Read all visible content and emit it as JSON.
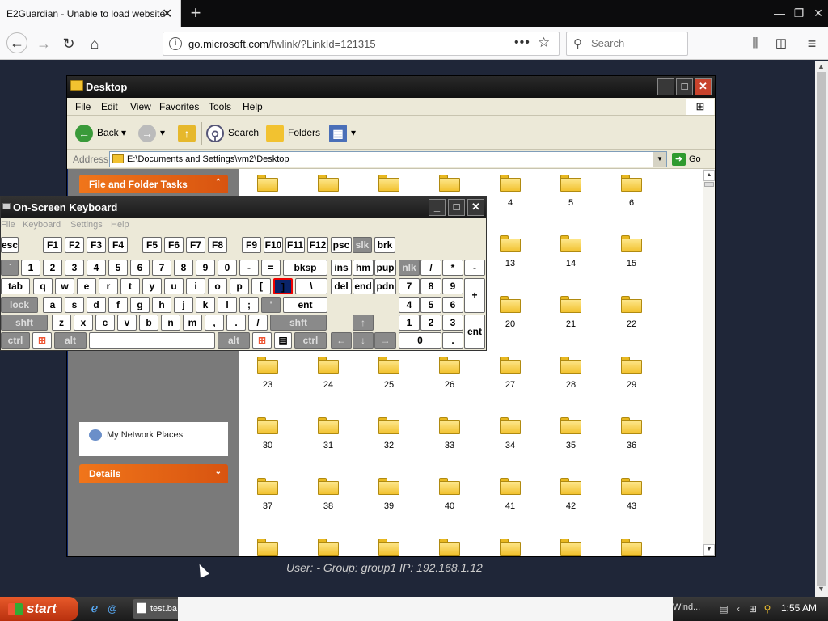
{
  "browser": {
    "tab_title": "E2Guardian - Unable to load website",
    "url_domain": "go.microsoft.com",
    "url_path": "/fwlink/?LinkId=121315",
    "search_placeholder": "Search"
  },
  "explorer": {
    "title": "Desktop",
    "menu": [
      "File",
      "Edit",
      "View",
      "Favorites",
      "Tools",
      "Help"
    ],
    "toolbar": {
      "back": "Back",
      "search": "Search",
      "folders": "Folders"
    },
    "address_label": "Address",
    "address_value": "E:\\Documents and Settings\\vm2\\Desktop",
    "go_label": "Go",
    "panels": {
      "tasks": "File and Folder Tasks",
      "network_places": "My Network Places",
      "details": "Details"
    },
    "files": [
      "",
      "",
      "",
      "",
      "4",
      "5",
      "6",
      "",
      "",
      "",
      "",
      "13",
      "14",
      "15",
      "",
      "",
      "",
      "",
      "20",
      "21",
      "22",
      "23",
      "24",
      "25",
      "26",
      "27",
      "28",
      "29",
      "30",
      "31",
      "32",
      "33",
      "34",
      "35",
      "36",
      "37",
      "38",
      "39",
      "40",
      "41",
      "42",
      "43",
      "",
      "",
      "",
      "",
      "",
      "",
      ""
    ]
  },
  "status_line": "User: -    Group: group1   IP: 192.168.1.12",
  "osk": {
    "title": "On-Screen Keyboard",
    "menu": [
      "File",
      "Keyboard",
      "Settings",
      "Help"
    ],
    "keys": {
      "esc": "esc",
      "f1": "F1",
      "f2": "F2",
      "f3": "F3",
      "f4": "F4",
      "f5": "F5",
      "f6": "F6",
      "f7": "F7",
      "f8": "F8",
      "f9": "F9",
      "f10": "F10",
      "f11": "F11",
      "f12": "F12",
      "psc": "psc",
      "slk": "slk",
      "brk": "brk",
      "grave": "`",
      "n1": "1",
      "n2": "2",
      "n3": "3",
      "n4": "4",
      "n5": "5",
      "n6": "6",
      "n7": "7",
      "n8": "8",
      "n9": "9",
      "n0": "0",
      "minus": "-",
      "equals": "=",
      "bksp": "bksp",
      "ins": "ins",
      "hm": "hm",
      "pup": "pup",
      "nlk": "nlk",
      "div": "/",
      "mul": "*",
      "sub": "-",
      "tab": "tab",
      "q": "q",
      "w": "w",
      "e": "e",
      "r": "r",
      "t": "t",
      "y": "y",
      "u": "u",
      "i": "i",
      "o": "o",
      "p": "p",
      "lbr": "[",
      "rbr": "]",
      "bsl": "\\",
      "del": "del",
      "end": "end",
      "pdn": "pdn",
      "k7": "7",
      "k8": "8",
      "k9": "9",
      "add": "+",
      "lock": "lock",
      "a": "a",
      "s": "s",
      "d": "d",
      "f": "f",
      "g": "g",
      "h": "h",
      "j": "j",
      "k": "k",
      "l": "l",
      "semi": ";",
      "quote": "'",
      "ent": "ent",
      "k4": "4",
      "k5": "5",
      "k6": "6",
      "lshft": "shft",
      "z": "z",
      "x": "x",
      "c": "c",
      "v": "v",
      "b": "b",
      "n": "n",
      "m": "m",
      "comma": ",",
      "period": ".",
      "slash": "/",
      "rshft": "shft",
      "up": "↑",
      "k1": "1",
      "k2": "2",
      "k3": "3",
      "kent": "ent",
      "lctrl": "ctrl",
      "lalt": "alt",
      "ralt": "alt",
      "rctrl": "ctrl",
      "left": "←",
      "down": "↓",
      "right": "→",
      "k0": "0",
      "kdot": "."
    }
  },
  "taskbar": {
    "start": "start",
    "task_item": "test.ba",
    "task_right": "Wind...",
    "clock": "1:55 AM"
  }
}
